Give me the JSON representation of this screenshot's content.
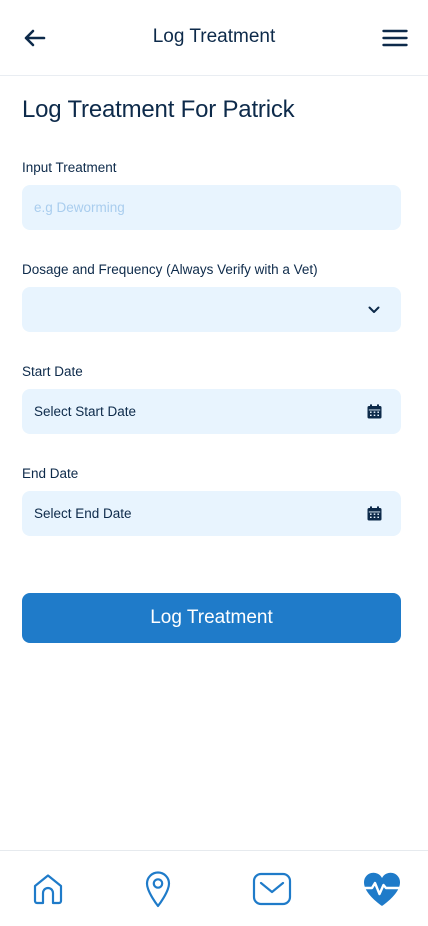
{
  "header": {
    "title": "Log Treatment",
    "back_icon": "arrow-left-icon",
    "menu_icon": "hamburger-menu-icon"
  },
  "page": {
    "title": "Log Treatment For Patrick"
  },
  "form": {
    "treatment": {
      "label": "Input Treatment",
      "placeholder": "e.g Deworming",
      "value": ""
    },
    "dosage": {
      "label": "Dosage and Frequency (Always Verify with a Vet)",
      "value": "",
      "icon": "chevron-down-icon"
    },
    "start_date": {
      "label": "Start Date",
      "value": "Select Start Date",
      "icon": "calendar-icon"
    },
    "end_date": {
      "label": "End Date",
      "value": "Select End Date",
      "icon": "calendar-icon"
    },
    "submit_label": "Log Treatment"
  },
  "bottom_nav": {
    "items": [
      {
        "icon": "home-icon",
        "active": false
      },
      {
        "icon": "map-pin-icon",
        "active": false
      },
      {
        "icon": "mail-icon",
        "active": false
      },
      {
        "icon": "heart-pulse-icon",
        "active": true
      }
    ]
  },
  "colors": {
    "primary": "#1f7bc9",
    "text": "#0d2a4a",
    "field_bg": "#e8f4fe",
    "placeholder": "#a9cdee"
  }
}
